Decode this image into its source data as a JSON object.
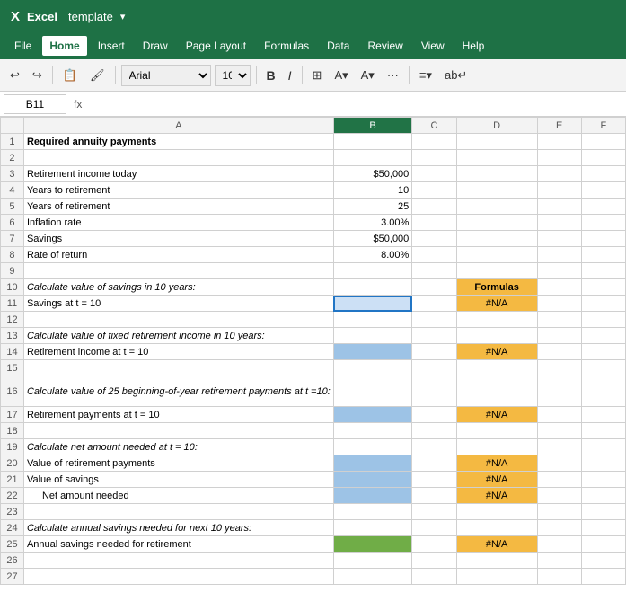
{
  "titlebar": {
    "app": "Excel",
    "template_label": "template",
    "dropdown_arrow": "▾"
  },
  "menubar": {
    "items": [
      "File",
      "Home",
      "Insert",
      "Draw",
      "Page Layout",
      "Formulas",
      "Data",
      "Review",
      "View",
      "Help"
    ]
  },
  "toolbar": {
    "font": "Arial",
    "size": "10",
    "bold": "B",
    "italic": "I"
  },
  "formulabar": {
    "cell_ref": "B11",
    "fx": "fx"
  },
  "columns": {
    "headers": [
      "",
      "A",
      "B",
      "C",
      "D",
      "E",
      "F"
    ]
  },
  "rows": [
    {
      "num": "1",
      "a": "Required annuity payments",
      "b": "",
      "c": "",
      "d": "",
      "bold_a": true
    },
    {
      "num": "2",
      "a": "",
      "b": "",
      "c": "",
      "d": ""
    },
    {
      "num": "3",
      "a": "Retirement income today",
      "b": "$50,000",
      "c": "",
      "d": ""
    },
    {
      "num": "4",
      "a": "Years to retirement",
      "b": "10",
      "c": "",
      "d": ""
    },
    {
      "num": "5",
      "a": "Years of retirement",
      "b": "25",
      "c": "",
      "d": ""
    },
    {
      "num": "6",
      "a": "Inflation rate",
      "b": "3.00%",
      "c": "",
      "d": ""
    },
    {
      "num": "7",
      "a": "Savings",
      "b": "$50,000",
      "c": "",
      "d": ""
    },
    {
      "num": "8",
      "a": "Rate of return",
      "b": "8.00%",
      "c": "",
      "d": ""
    },
    {
      "num": "9",
      "a": "",
      "b": "",
      "c": "",
      "d": ""
    },
    {
      "num": "10",
      "a": "Calculate value of savings in 10 years:",
      "b": "",
      "c": "",
      "d": "Formulas",
      "italic_a": true
    },
    {
      "num": "11",
      "a": "Savings at t = 10",
      "b": "",
      "c": "",
      "d": "#N/A",
      "selected_b": true
    },
    {
      "num": "12",
      "a": "",
      "b": "",
      "c": "",
      "d": ""
    },
    {
      "num": "13",
      "a": "Calculate value of fixed retirement income in 10 years:",
      "b": "",
      "c": "",
      "d": "",
      "italic_a": true
    },
    {
      "num": "14",
      "a": "Retirement income at t = 10",
      "b": "",
      "c": "",
      "d": "#N/A"
    },
    {
      "num": "15",
      "a": "",
      "b": "",
      "c": "",
      "d": ""
    },
    {
      "num": "16",
      "a": "Calculate value of 25 beginning-of-year retirement payments at t =10:",
      "b": "",
      "c": "",
      "d": "",
      "italic_a": true,
      "tall": true
    },
    {
      "num": "17",
      "a": "Retirement payments at t = 10",
      "b": "",
      "c": "",
      "d": "#N/A"
    },
    {
      "num": "18",
      "a": "",
      "b": "",
      "c": "",
      "d": ""
    },
    {
      "num": "19",
      "a": "Calculate net amount needed at t = 10:",
      "b": "",
      "c": "",
      "d": "",
      "italic_a": true
    },
    {
      "num": "20",
      "a": "Value of retirement payments",
      "b": "",
      "c": "",
      "d": "#N/A"
    },
    {
      "num": "21",
      "a": "Value of savings",
      "b": "",
      "c": "",
      "d": "#N/A"
    },
    {
      "num": "22",
      "a": "Net amount needed",
      "b": "",
      "c": "",
      "d": "#N/A",
      "indent_a": true
    },
    {
      "num": "23",
      "a": "",
      "b": "",
      "c": "",
      "d": ""
    },
    {
      "num": "24",
      "a": "Calculate annual savings needed for next 10 years:",
      "b": "",
      "c": "",
      "d": "",
      "italic_a": true
    },
    {
      "num": "25",
      "a": "Annual savings needed for retirement",
      "b": "",
      "c": "",
      "d": "#N/A"
    },
    {
      "num": "26",
      "a": "",
      "b": "",
      "c": "",
      "d": ""
    },
    {
      "num": "27",
      "a": "",
      "b": "",
      "c": "",
      "d": ""
    }
  ],
  "colors": {
    "header_green": "#1e7145",
    "cell_blue": "#9dc3e6",
    "cell_orange": "#f4b942",
    "cell_green": "#70ad47",
    "excel_green": "#217346"
  }
}
